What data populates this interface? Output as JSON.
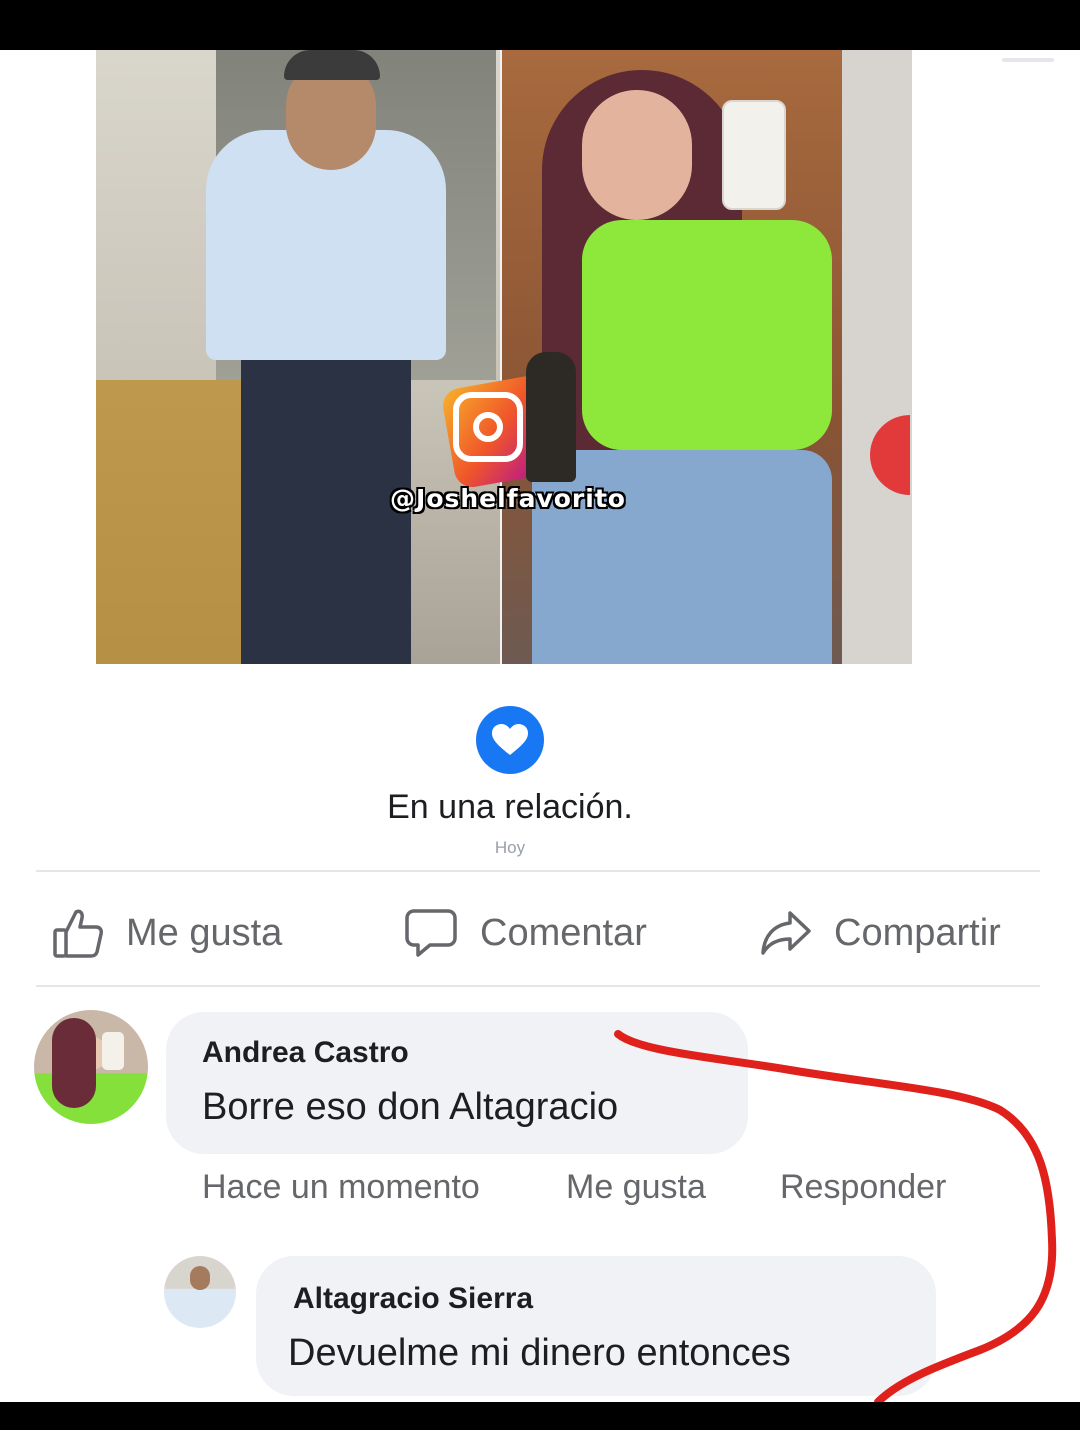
{
  "post": {
    "image_watermark": "@Joshelfavorito",
    "status_label": "En una relación.",
    "status_time": "Hoy"
  },
  "actions": {
    "like": "Me gusta",
    "comment": "Comentar",
    "share": "Compartir"
  },
  "comments": [
    {
      "author": "Andrea Castro",
      "text": "Borre eso don Altagracio",
      "time": "Hace un momento",
      "like": "Me gusta",
      "reply": "Responder"
    },
    {
      "author": "Altagracio Sierra",
      "text": "Devuelme mi dinero entonces"
    }
  ],
  "colors": {
    "accent_blue": "#1877f2",
    "annotation_red": "#e0201b",
    "bubble_gray": "#f0f2f5",
    "meta_gray": "#65676b"
  }
}
